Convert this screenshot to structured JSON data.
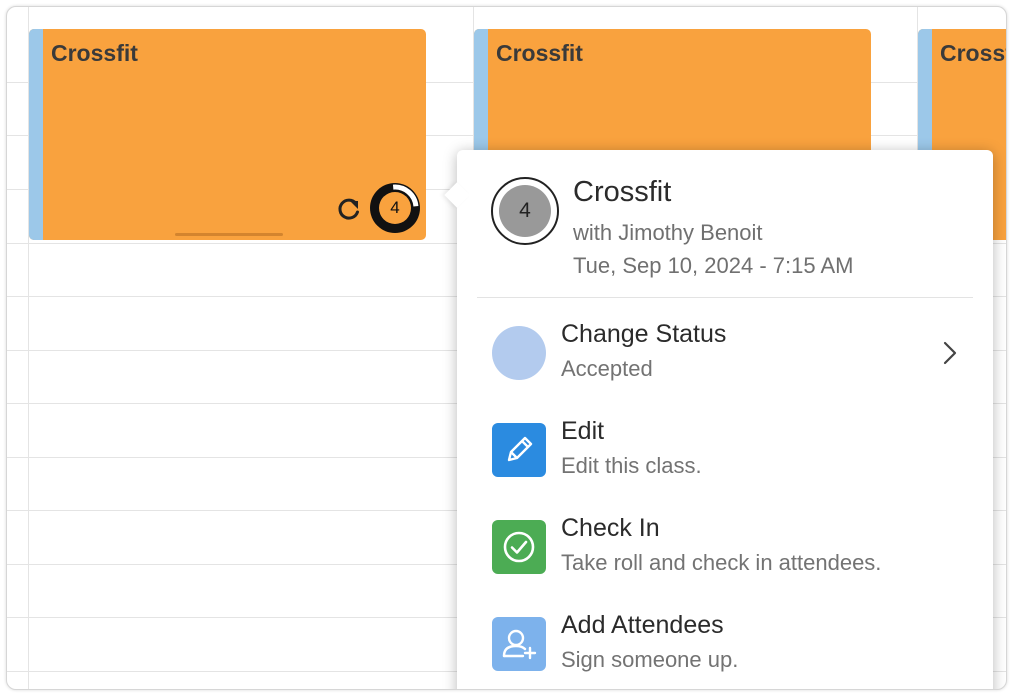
{
  "events": [
    {
      "title": "Crossfit",
      "count": "4"
    },
    {
      "title": "Crossfit"
    },
    {
      "title": "Crossfit"
    }
  ],
  "popover": {
    "attendee_count": "4",
    "title": "Crossfit",
    "instructor": "with Jimothy Benoit",
    "datetime": "Tue, Sep 10, 2024 - 7:15 AM",
    "items": [
      {
        "title": "Change Status",
        "desc": "Accepted",
        "icon": "status-dot"
      },
      {
        "title": "Edit",
        "desc": "Edit this class.",
        "icon": "pencil-icon"
      },
      {
        "title": "Check In",
        "desc": "Take roll and check in attendees.",
        "icon": "check-circle-icon"
      },
      {
        "title": "Add Attendees",
        "desc": "Sign someone up.",
        "icon": "add-user-icon"
      }
    ]
  },
  "colors": {
    "event_bg": "#f9a23e",
    "event_stripe": "#9cc8e9",
    "status_dot": "#b3cbee",
    "edit_icon": "#2b8be0",
    "checkin_icon": "#4cac54",
    "add_attendees_icon": "#7db2ec"
  }
}
